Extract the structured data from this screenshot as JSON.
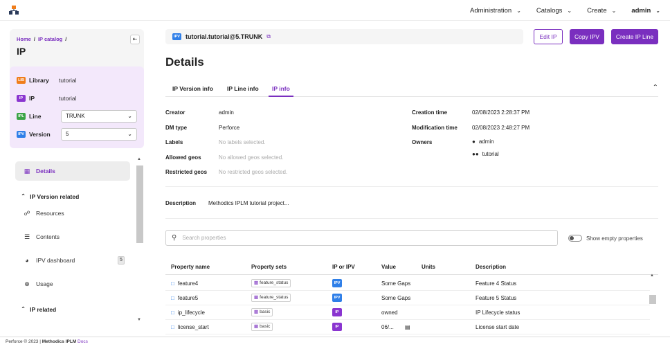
{
  "topbar": {
    "menus": [
      {
        "label": "Administration"
      },
      {
        "label": "Catalogs"
      },
      {
        "label": "Create"
      },
      {
        "label": "admin"
      }
    ]
  },
  "sidebar": {
    "breadcrumb": {
      "home": "Home",
      "catalog": "IP catalog",
      "sep": "/"
    },
    "title": "IP",
    "info": {
      "library": {
        "badge": "LIB",
        "label": "Library",
        "value": "tutorial"
      },
      "ip": {
        "badge": "IP",
        "label": "IP",
        "value": "tutorial"
      },
      "line": {
        "badge": "IPL",
        "label": "Line",
        "value": "TRUNK"
      },
      "version": {
        "badge": "IPV",
        "label": "Version",
        "value": "5"
      }
    },
    "nav": {
      "details": "Details",
      "ipv_section": "IP Version related",
      "resources": "Resources",
      "contents": "Contents",
      "ipv_dashboard": "IPV dashboard",
      "ipv_dashboard_count": "5",
      "usage": "Usage",
      "ip_section": "IP related"
    }
  },
  "main": {
    "ipv_badge": "IPV",
    "ipv_name": "tutorial.tutorial@5.TRUNK",
    "buttons": {
      "edit": "Edit IP",
      "copy": "Copy IPV",
      "create_line": "Create IP Line"
    },
    "title": "Details",
    "tabs": [
      "IP Version info",
      "IP Line info",
      "IP info"
    ],
    "fields": {
      "creator": {
        "label": "Creator",
        "value": "admin"
      },
      "dm_type": {
        "label": "DM type",
        "value": "Perforce"
      },
      "labels": {
        "label": "Labels",
        "value": "No labels selected."
      },
      "allowed_geos": {
        "label": "Allowed geos",
        "value": "No allowed geos selected."
      },
      "restricted_geos": {
        "label": "Restricted geos",
        "value": "No restricted geos selected."
      },
      "creation_time": {
        "label": "Creation time",
        "value": "02/08/2023 2:28:37 PM"
      },
      "modification_time": {
        "label": "Modification time",
        "value": "02/08/2023 2:48:27 PM"
      },
      "owners": {
        "label": "Owners",
        "user": "admin",
        "group": "tutorial"
      }
    },
    "description": {
      "label": "Description",
      "value": "Methodics IPLM tutorial project..."
    },
    "search": {
      "placeholder": "Search properties"
    },
    "show_empty_label": "Show empty properties",
    "table": {
      "columns": [
        "Property name",
        "Property sets",
        "IP or IPV",
        "Value",
        "Units",
        "Description"
      ],
      "rows": [
        {
          "name": "feature4",
          "set": "feature_status",
          "type": "IPV",
          "value": "Some Gaps",
          "units": "",
          "description": "Feature 4 Status"
        },
        {
          "name": "feature5",
          "set": "feature_status",
          "type": "IPV",
          "value": "Some Gaps",
          "units": "",
          "description": "Feature 5 Status"
        },
        {
          "name": "ip_lifecycle",
          "set": "basic",
          "type": "IP",
          "value": "owned",
          "units": "",
          "description": "IP Lifecycle status"
        },
        {
          "name": "license_start",
          "set": "basic",
          "type": "IP",
          "value": "06/...",
          "units": "",
          "description": "License start date"
        }
      ]
    }
  },
  "footer": {
    "copyright": "Perforce © 2023 |",
    "brand": "Methodics IPLM",
    "docs": "Docs"
  }
}
